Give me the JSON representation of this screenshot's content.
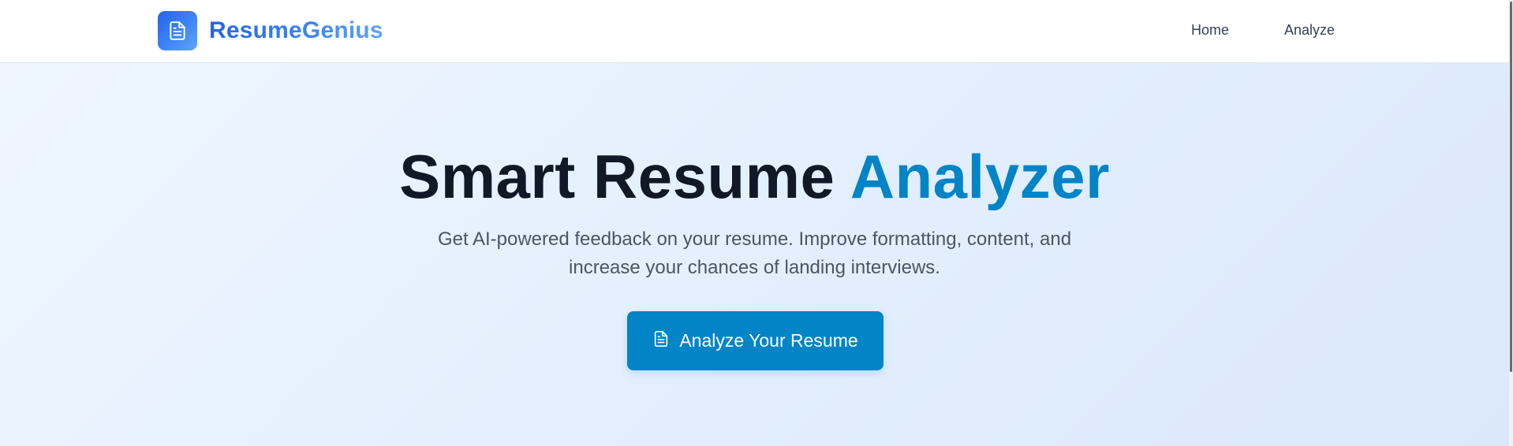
{
  "navbar": {
    "brand_name": "ResumeGenius",
    "brand_icon": "document-icon",
    "links": [
      {
        "label": "Home"
      },
      {
        "label": "Analyze"
      }
    ]
  },
  "hero": {
    "title_part1": "Smart Resume ",
    "title_accent": "Analyzer",
    "subtitle": "Get AI-powered feedback on your resume. Improve formatting, content, and increase your chances of landing interviews.",
    "cta_label": "Analyze Your Resume",
    "cta_icon": "document-icon"
  },
  "colors": {
    "accent": "#0284c7",
    "brand_blue": "#2563eb",
    "title_dark": "#111827",
    "hero_bg": "#eaf3fd"
  }
}
